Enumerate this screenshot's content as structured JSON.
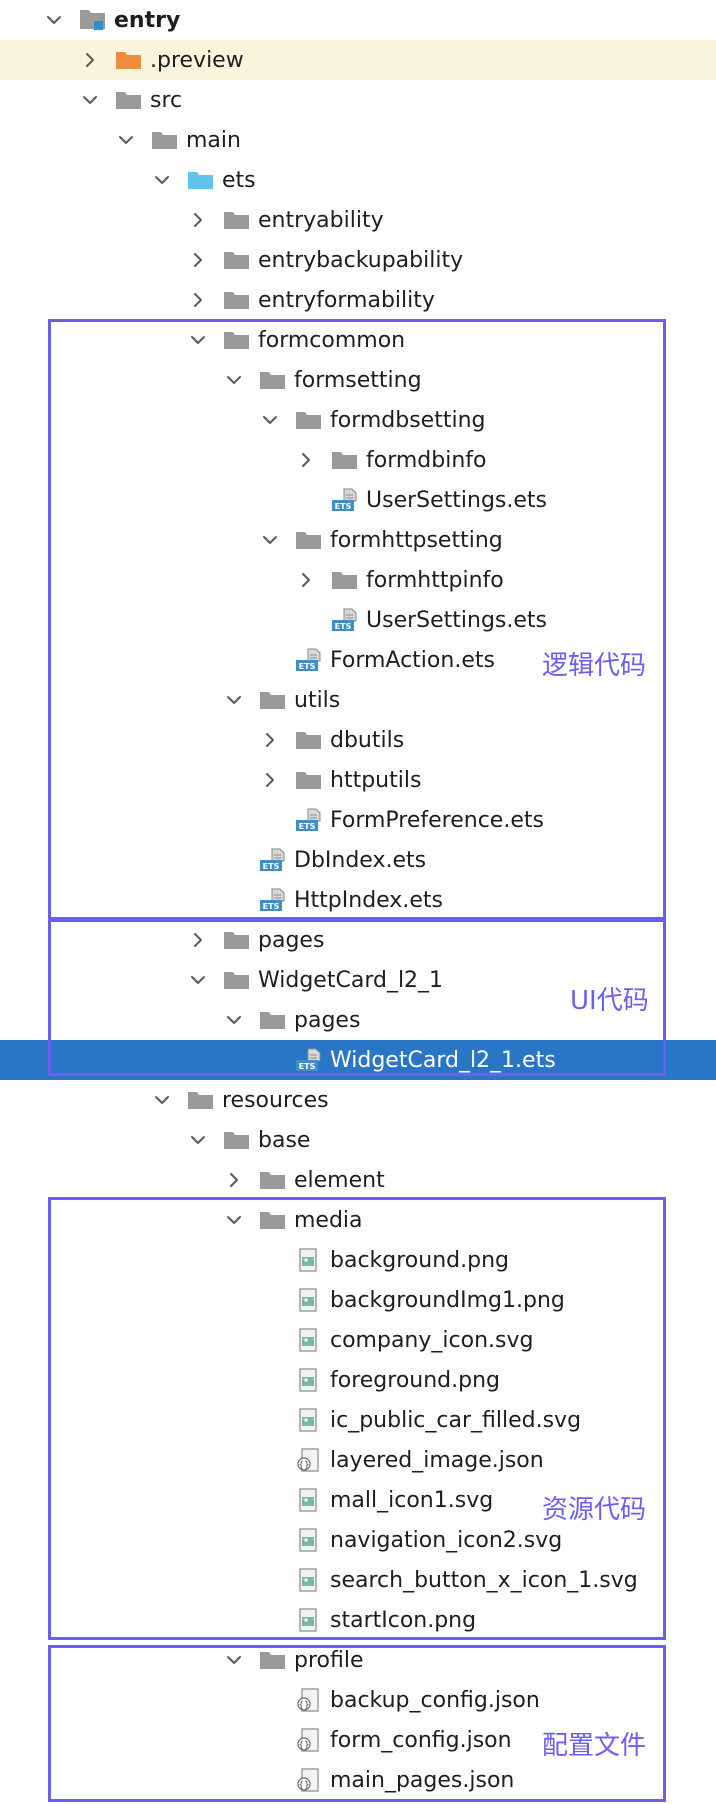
{
  "tree": {
    "rows": [
      {
        "label": "entry",
        "chevron": "down",
        "icon": "module-folder-icon",
        "bold": true
      },
      {
        "label": ".preview",
        "chevron": "right",
        "icon": "folder-orange-icon"
      },
      {
        "label": "src",
        "chevron": "down",
        "icon": "folder-icon"
      },
      {
        "label": "main",
        "chevron": "down",
        "icon": "folder-icon"
      },
      {
        "label": "ets",
        "chevron": "down",
        "icon": "folder-blue-icon"
      },
      {
        "label": "entryability",
        "chevron": "right",
        "icon": "folder-icon"
      },
      {
        "label": "entrybackupability",
        "chevron": "right",
        "icon": "folder-icon"
      },
      {
        "label": "entryformability",
        "chevron": "right",
        "icon": "folder-icon"
      },
      {
        "label": "formcommon",
        "chevron": "down",
        "icon": "folder-icon"
      },
      {
        "label": "formsetting",
        "chevron": "down",
        "icon": "folder-icon"
      },
      {
        "label": "formdbsetting",
        "chevron": "down",
        "icon": "folder-icon"
      },
      {
        "label": "formdbinfo",
        "chevron": "right",
        "icon": "folder-icon"
      },
      {
        "label": "UserSettings.ets",
        "chevron": "",
        "icon": "ets-file-icon"
      },
      {
        "label": "formhttpsetting",
        "chevron": "down",
        "icon": "folder-icon"
      },
      {
        "label": "formhttpinfo",
        "chevron": "right",
        "icon": "folder-icon"
      },
      {
        "label": "UserSettings.ets",
        "chevron": "",
        "icon": "ets-file-icon"
      },
      {
        "label": "FormAction.ets",
        "chevron": "",
        "icon": "ets-file-icon"
      },
      {
        "label": "utils",
        "chevron": "down",
        "icon": "folder-icon"
      },
      {
        "label": "dbutils",
        "chevron": "right",
        "icon": "folder-icon"
      },
      {
        "label": "httputils",
        "chevron": "right",
        "icon": "folder-icon"
      },
      {
        "label": "FormPreference.ets",
        "chevron": "",
        "icon": "ets-file-icon"
      },
      {
        "label": "DbIndex.ets",
        "chevron": "",
        "icon": "ets-file-icon"
      },
      {
        "label": "HttpIndex.ets",
        "chevron": "",
        "icon": "ets-file-icon"
      },
      {
        "label": "pages",
        "chevron": "right",
        "icon": "folder-icon"
      },
      {
        "label": "WidgetCard_l2_1",
        "chevron": "down",
        "icon": "folder-icon"
      },
      {
        "label": "pages",
        "chevron": "down",
        "icon": "folder-icon"
      },
      {
        "label": "WidgetCard_l2_1.ets",
        "chevron": "",
        "icon": "ets-file-icon",
        "selected": true
      },
      {
        "label": "resources",
        "chevron": "down",
        "icon": "folder-icon"
      },
      {
        "label": "base",
        "chevron": "down",
        "icon": "folder-icon"
      },
      {
        "label": "element",
        "chevron": "right",
        "icon": "folder-icon"
      },
      {
        "label": "media",
        "chevron": "down",
        "icon": "folder-icon"
      },
      {
        "label": "background.png",
        "chevron": "",
        "icon": "image-file-icon"
      },
      {
        "label": "backgroundImg1.png",
        "chevron": "",
        "icon": "image-file-icon"
      },
      {
        "label": "company_icon.svg",
        "chevron": "",
        "icon": "image-file-icon"
      },
      {
        "label": "foreground.png",
        "chevron": "",
        "icon": "image-file-icon"
      },
      {
        "label": "ic_public_car_filled.svg",
        "chevron": "",
        "icon": "image-file-icon"
      },
      {
        "label": "layered_image.json",
        "chevron": "",
        "icon": "json-file-icon"
      },
      {
        "label": "mall_icon1.svg",
        "chevron": "",
        "icon": "image-file-icon"
      },
      {
        "label": "navigation_icon2.svg",
        "chevron": "",
        "icon": "image-file-icon"
      },
      {
        "label": "search_button_x_icon_1.svg",
        "chevron": "",
        "icon": "image-file-icon"
      },
      {
        "label": "startIcon.png",
        "chevron": "",
        "icon": "image-file-icon"
      },
      {
        "label": "profile",
        "chevron": "down",
        "icon": "folder-icon"
      },
      {
        "label": "backup_config.json",
        "chevron": "",
        "icon": "json-file-icon"
      },
      {
        "label": "form_config.json",
        "chevron": "",
        "icon": "json-file-icon"
      },
      {
        "label": "main_pages.json",
        "chevron": "",
        "icon": "json-file-icon"
      }
    ]
  },
  "annotations": {
    "logic": "逻辑代码",
    "ui": "UI代码",
    "resources": "资源代码",
    "config": "配置文件"
  },
  "colors": {
    "accent": "#6b5ff2",
    "selected_row": "#2a76c6",
    "highlight_row": "#f7f6dc",
    "folder": "#9a9a9a",
    "folder_blue": "#62c3ec",
    "folder_orange": "#f08a3e"
  }
}
